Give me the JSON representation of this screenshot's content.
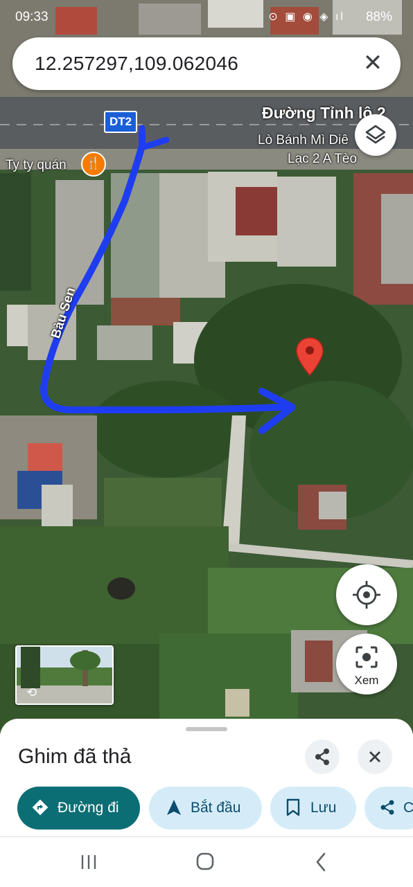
{
  "status_bar": {
    "time": "09:33",
    "battery": "88%",
    "icons": "⊙ ▣ ◉ ◈ ıl"
  },
  "search": {
    "coords": "12.257297,109.062046",
    "clear_icon": "close-icon"
  },
  "map": {
    "route_shield": "DT2",
    "road_name": "Đường Tỉnh lộ 2",
    "place_1": "Ty ty quán",
    "place_1_icon": "restaurant-icon",
    "place_2_line1": "Lò Bánh Mì Diê",
    "place_2_line2": "Lạc 2 A Tèo",
    "street_label": "Bàu Sen",
    "marker_icon": "red-pin-icon",
    "route_color": "#1f3df0",
    "pin_color": "#ea4335"
  },
  "controls": {
    "layers_icon": "layers-icon",
    "locate_icon": "crosshair-icon",
    "xem_label": "Xem",
    "xem_icon": "lens-icon"
  },
  "sheet": {
    "title": "Ghim đã thả",
    "share_icon": "share-icon",
    "close_icon": "close-icon",
    "buttons": [
      {
        "label": "Đường đi",
        "icon": "directions-icon"
      },
      {
        "label": "Bắt đầu",
        "icon": "navigation-arrow-icon"
      },
      {
        "label": "Lưu",
        "icon": "bookmark-icon"
      },
      {
        "label": "C",
        "icon": "share-icon"
      }
    ]
  },
  "navbar": {
    "recent_icon": "recent-apps-icon",
    "home_icon": "home-icon",
    "back_icon": "back-icon"
  }
}
